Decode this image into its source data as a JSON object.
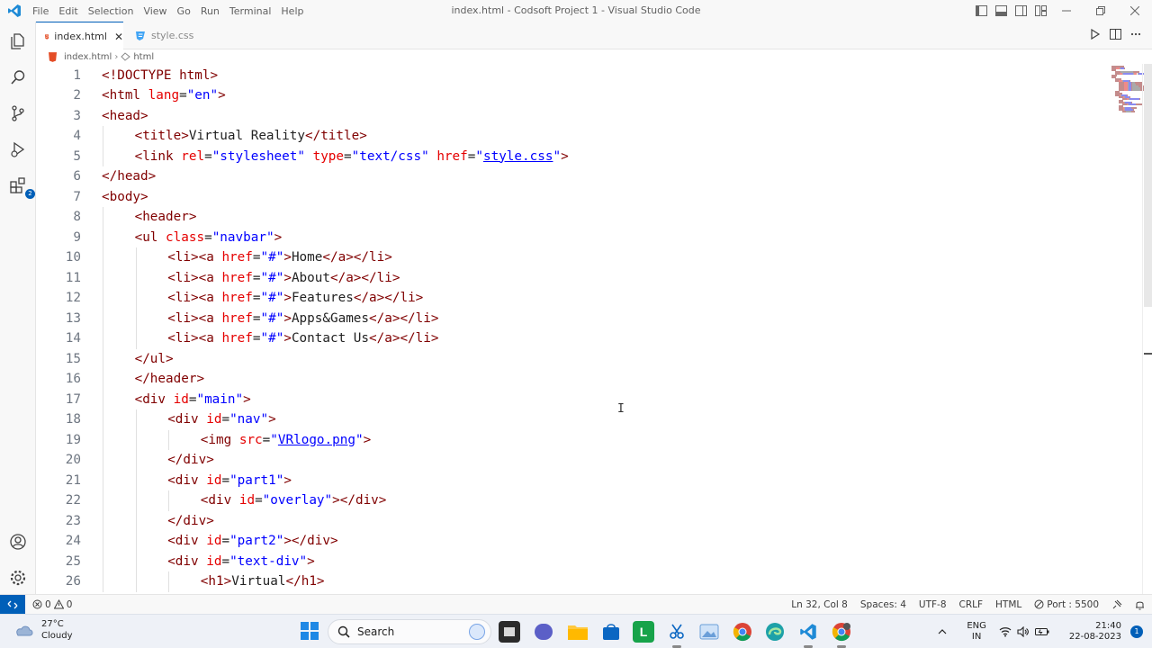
{
  "window": {
    "title": "index.html - Codsoft Project 1 - Visual Studio Code",
    "menu": [
      "File",
      "Edit",
      "Selection",
      "View",
      "Go",
      "Run",
      "Terminal",
      "Help"
    ]
  },
  "tabs": [
    {
      "label": "index.html",
      "active": true
    },
    {
      "label": "style.css",
      "active": false
    }
  ],
  "breadcrumb": {
    "file": "index.html",
    "symbol": "html"
  },
  "activity_badge": "2",
  "code_lines": [
    {
      "n": "1",
      "indent": 0,
      "tokens": [
        [
          "t",
          "<!DOCTYPE html>"
        ]
      ]
    },
    {
      "n": "2",
      "indent": 0,
      "tokens": [
        [
          "t",
          "<html "
        ],
        [
          "a",
          "lang"
        ],
        [
          "p",
          "="
        ],
        [
          "s",
          "\"en\""
        ],
        [
          "t",
          ">"
        ]
      ]
    },
    {
      "n": "3",
      "indent": 0,
      "tokens": [
        [
          "t",
          "<head>"
        ]
      ]
    },
    {
      "n": "4",
      "indent": 1,
      "tokens": [
        [
          "t",
          "<title>"
        ],
        [
          "p",
          "Virtual Reality"
        ],
        [
          "t",
          "</title>"
        ]
      ]
    },
    {
      "n": "5",
      "indent": 1,
      "tokens": [
        [
          "t",
          "<link "
        ],
        [
          "a",
          "rel"
        ],
        [
          "p",
          "="
        ],
        [
          "s",
          "\"stylesheet\""
        ],
        [
          "p",
          " "
        ],
        [
          "a",
          "type"
        ],
        [
          "p",
          "="
        ],
        [
          "s",
          "\"text/css\""
        ],
        [
          "p",
          " "
        ],
        [
          "a",
          "href"
        ],
        [
          "p",
          "="
        ],
        [
          "s",
          "\""
        ],
        [
          "u",
          "style.css"
        ],
        [
          "s",
          "\""
        ],
        [
          "t",
          ">"
        ]
      ]
    },
    {
      "n": "6",
      "indent": 0,
      "tokens": [
        [
          "t",
          "</head>"
        ]
      ]
    },
    {
      "n": "7",
      "indent": 0,
      "tokens": [
        [
          "t",
          "<body>"
        ]
      ]
    },
    {
      "n": "8",
      "indent": 1,
      "tokens": [
        [
          "t",
          "<header>"
        ]
      ]
    },
    {
      "n": "9",
      "indent": 1,
      "tokens": [
        [
          "t",
          "<ul "
        ],
        [
          "a",
          "class"
        ],
        [
          "p",
          "="
        ],
        [
          "s",
          "\"navbar\""
        ],
        [
          "t",
          ">"
        ]
      ]
    },
    {
      "n": "10",
      "indent": 2,
      "tokens": [
        [
          "t",
          "<li><a "
        ],
        [
          "a",
          "href"
        ],
        [
          "p",
          "="
        ],
        [
          "s",
          "\"#\""
        ],
        [
          "t",
          ">"
        ],
        [
          "p",
          "Home"
        ],
        [
          "t",
          "</a></li>"
        ]
      ]
    },
    {
      "n": "11",
      "indent": 2,
      "tokens": [
        [
          "t",
          "<li><a "
        ],
        [
          "a",
          "href"
        ],
        [
          "p",
          "="
        ],
        [
          "s",
          "\"#\""
        ],
        [
          "t",
          ">"
        ],
        [
          "p",
          "About"
        ],
        [
          "t",
          "</a></li>"
        ]
      ]
    },
    {
      "n": "12",
      "indent": 2,
      "tokens": [
        [
          "t",
          "<li><a "
        ],
        [
          "a",
          "href"
        ],
        [
          "p",
          "="
        ],
        [
          "s",
          "\"#\""
        ],
        [
          "t",
          ">"
        ],
        [
          "p",
          "Features"
        ],
        [
          "t",
          "</a></li>"
        ]
      ]
    },
    {
      "n": "13",
      "indent": 2,
      "tokens": [
        [
          "t",
          "<li><a "
        ],
        [
          "a",
          "href"
        ],
        [
          "p",
          "="
        ],
        [
          "s",
          "\"#\""
        ],
        [
          "t",
          ">"
        ],
        [
          "p",
          "Apps&Games"
        ],
        [
          "t",
          "</a></li>"
        ]
      ]
    },
    {
      "n": "14",
      "indent": 2,
      "tokens": [
        [
          "t",
          "<li><a "
        ],
        [
          "a",
          "href"
        ],
        [
          "p",
          "="
        ],
        [
          "s",
          "\"#\""
        ],
        [
          "t",
          ">"
        ],
        [
          "p",
          "Contact Us"
        ],
        [
          "t",
          "</a></li>"
        ]
      ]
    },
    {
      "n": "15",
      "indent": 1,
      "tokens": [
        [
          "t",
          "</ul>"
        ]
      ]
    },
    {
      "n": "16",
      "indent": 1,
      "tokens": [
        [
          "t",
          "</header>"
        ]
      ]
    },
    {
      "n": "17",
      "indent": 1,
      "tokens": [
        [
          "t",
          "<div "
        ],
        [
          "a",
          "id"
        ],
        [
          "p",
          "="
        ],
        [
          "s",
          "\"main\""
        ],
        [
          "t",
          ">"
        ]
      ]
    },
    {
      "n": "18",
      "indent": 2,
      "tokens": [
        [
          "t",
          "<div "
        ],
        [
          "a",
          "id"
        ],
        [
          "p",
          "="
        ],
        [
          "s",
          "\"nav\""
        ],
        [
          "t",
          ">"
        ]
      ]
    },
    {
      "n": "19",
      "indent": 3,
      "tokens": [
        [
          "t",
          "<img "
        ],
        [
          "a",
          "src"
        ],
        [
          "p",
          "="
        ],
        [
          "s",
          "\""
        ],
        [
          "u",
          "VRlogo.png"
        ],
        [
          "s",
          "\""
        ],
        [
          "t",
          ">"
        ]
      ]
    },
    {
      "n": "20",
      "indent": 2,
      "tokens": [
        [
          "t",
          "</div>"
        ]
      ]
    },
    {
      "n": "21",
      "indent": 2,
      "tokens": [
        [
          "t",
          "<div "
        ],
        [
          "a",
          "id"
        ],
        [
          "p",
          "="
        ],
        [
          "s",
          "\"part1\""
        ],
        [
          "t",
          ">"
        ]
      ]
    },
    {
      "n": "22",
      "indent": 3,
      "tokens": [
        [
          "t",
          "<div "
        ],
        [
          "a",
          "id"
        ],
        [
          "p",
          "="
        ],
        [
          "s",
          "\"overlay\""
        ],
        [
          "t",
          "></div>"
        ]
      ]
    },
    {
      "n": "23",
      "indent": 2,
      "tokens": [
        [
          "t",
          "</div>"
        ]
      ]
    },
    {
      "n": "24",
      "indent": 2,
      "tokens": [
        [
          "t",
          "<div "
        ],
        [
          "a",
          "id"
        ],
        [
          "p",
          "="
        ],
        [
          "s",
          "\"part2\""
        ],
        [
          "t",
          "></div>"
        ]
      ]
    },
    {
      "n": "25",
      "indent": 2,
      "tokens": [
        [
          "t",
          "<div "
        ],
        [
          "a",
          "id"
        ],
        [
          "p",
          "="
        ],
        [
          "s",
          "\"text-div\""
        ],
        [
          "t",
          ">"
        ]
      ]
    },
    {
      "n": "26",
      "indent": 3,
      "tokens": [
        [
          "t",
          "<h1>"
        ],
        [
          "p",
          "Virtual"
        ],
        [
          "t",
          "</h1>"
        ]
      ]
    }
  ],
  "statusbar": {
    "errors": "0",
    "warnings": "0",
    "position": "Ln 32, Col 8",
    "spaces": "Spaces: 4",
    "encoding": "UTF-8",
    "eol": "CRLF",
    "language": "HTML",
    "port": "Port : 5500"
  },
  "taskbar": {
    "temperature": "27°C",
    "weather": "Cloudy",
    "search_label": "Search",
    "lang_top": "ENG",
    "lang_bottom": "IN",
    "time": "21:40",
    "date": "22-08-2023",
    "notification_count": "1"
  },
  "colors": {
    "accent": "#005fb8",
    "tag": "#800000",
    "attribute": "#e50000",
    "string": "#0000ff"
  }
}
